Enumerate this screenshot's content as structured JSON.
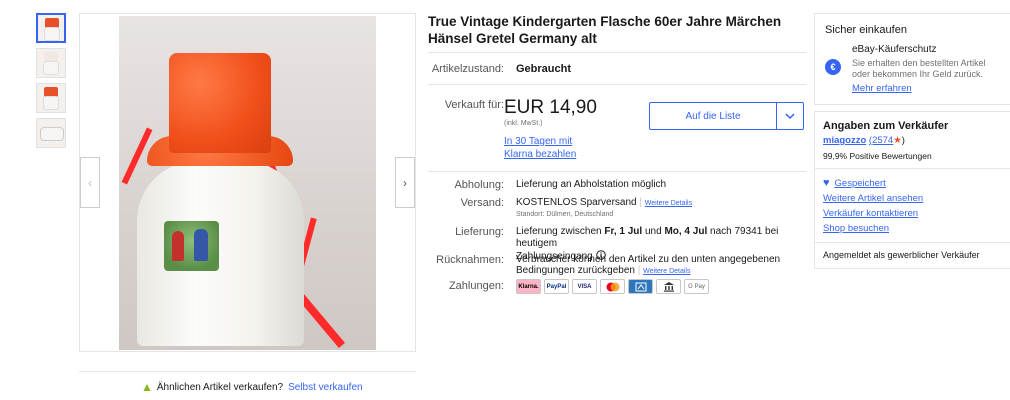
{
  "listing": {
    "title": "True Vintage Kindergarten Flasche 60er Jahre Märchen Hänsel Gretel Germany alt"
  },
  "gallery": {
    "prev_arrow": "‹",
    "next_arrow": "›"
  },
  "sell": {
    "question": "Ähnlichen Artikel verkaufen?",
    "link": "Selbst verkaufen"
  },
  "condition": {
    "label": "Artikelzustand:",
    "value": "Gebraucht"
  },
  "price": {
    "label": "Verkauft für:",
    "amount": "EUR 14,90",
    "tax_note": "(inkl. MwSt.)",
    "klarna_line1": "In 30 Tagen mit",
    "klarna_line2": "Klarna bezahlen"
  },
  "watch_button": {
    "label": "Auf die Liste",
    "chevron": "⌄"
  },
  "details": {
    "pickup_label": "Abholung:",
    "pickup_value": "Lieferung an Abholstation möglich",
    "shipping_label": "Versand:",
    "shipping_value": "KOSTENLOS Sparversand",
    "shipping_more": "Weitere Details",
    "location": "Standort: Dülmen, Deutschland",
    "delivery_label": "Lieferung:",
    "delivery_prefix": "Lieferung zwischen ",
    "delivery_from": "Fr, 1 Jul",
    "delivery_mid": " und ",
    "delivery_to": "Mo, 4 Jul",
    "delivery_suffix": " nach 79341 bei heutigem",
    "delivery_line2": "Zahlungseingang",
    "returns_label": "Rücknahmen:",
    "returns_line1": "Verbraucher können den Artikel zu den unten angegebenen",
    "returns_line2": "Bedingungen zurückgeben",
    "returns_more": "Weitere Details",
    "payments_label": "Zahlungen:"
  },
  "payment_methods": [
    "Klarna.",
    "PayPal",
    "VISA",
    "MC",
    "AMEX",
    "BANK",
    "G Pay"
  ],
  "protection": {
    "title": "Sicher einkaufen",
    "name": "eBay-Käuferschutz",
    "desc_line1": "Sie erhalten den bestellten Artikel",
    "desc_line2": "oder bekommen Ihr Geld zurück.",
    "link": "Mehr erfahren",
    "icon": "€"
  },
  "seller": {
    "title": "Angaben zum Verkäufer",
    "name": "miagozzo",
    "feedback_count": "(2574",
    "star": "★",
    "feedback_close": ")",
    "positive": "99,9% Positive Bewertungen",
    "saved": "Gespeichert",
    "more_items": "Weitere Artikel ansehen",
    "contact": "Verkäufer kontaktieren",
    "shop": "Shop besuchen",
    "type": "Angemeldet als gewerblicher Verkäufer"
  }
}
